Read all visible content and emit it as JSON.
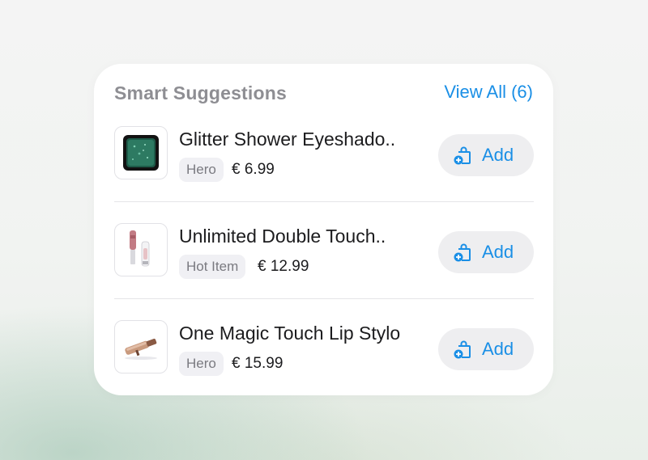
{
  "colors": {
    "accent": "#1a8fe6",
    "title": "#8e8e93",
    "badge_bg": "#f0f0f4"
  },
  "card": {
    "title": "Smart Suggestions",
    "view_all": "View All (6)"
  },
  "products": [
    {
      "name": "Glitter Shower Eyeshado..",
      "badge": "Hero",
      "price": "€ 6.99",
      "add_label": "Add",
      "thumb_icon": "eyeshadow-compact-icon"
    },
    {
      "name": "Unlimited Double Touch..",
      "badge": "Hot Item",
      "price": "€ 12.99",
      "add_label": "Add",
      "thumb_icon": "lip-gloss-icon"
    },
    {
      "name": "One Magic Touch Lip Stylo",
      "badge": "Hero",
      "price": "€ 15.99",
      "add_label": "Add",
      "thumb_icon": "lip-stylo-icon"
    }
  ]
}
